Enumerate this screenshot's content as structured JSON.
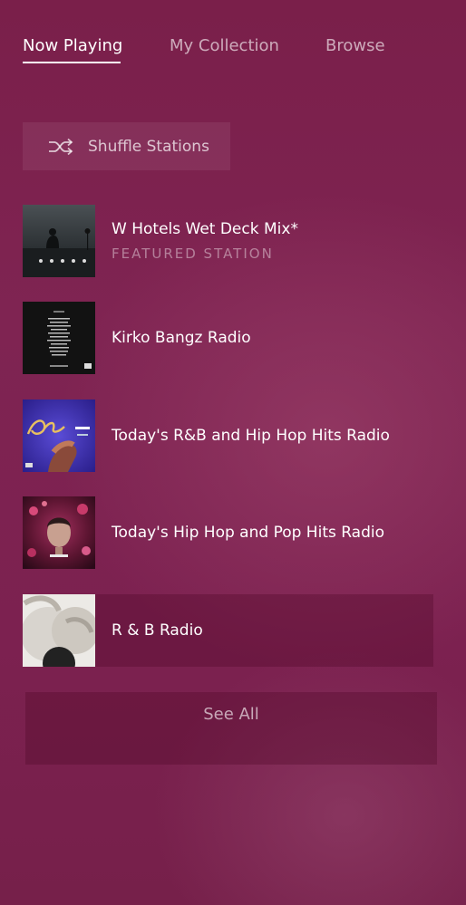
{
  "tabs": [
    {
      "label": "Now Playing",
      "active": true
    },
    {
      "label": "My Collection",
      "active": false
    },
    {
      "label": "Browse",
      "active": false
    }
  ],
  "shuffle": {
    "label": "Shuffle Stations",
    "icon": "shuffle-icon"
  },
  "stations": [
    {
      "title": "W Hotels Wet Deck Mix*",
      "subtitle": "FEATURED STATION"
    },
    {
      "title": "Kirko Bangz Radio"
    },
    {
      "title": "Today's R&B and Hip Hop Hits Radio"
    },
    {
      "title": "Today's Hip Hop and Pop Hits Radio"
    },
    {
      "title": "R & B Radio"
    }
  ],
  "see_all": {
    "label": "See All"
  },
  "colors": {
    "background": "#7c2150",
    "highlight_row": "#651839",
    "tab_inactive": "#d9aec2"
  }
}
